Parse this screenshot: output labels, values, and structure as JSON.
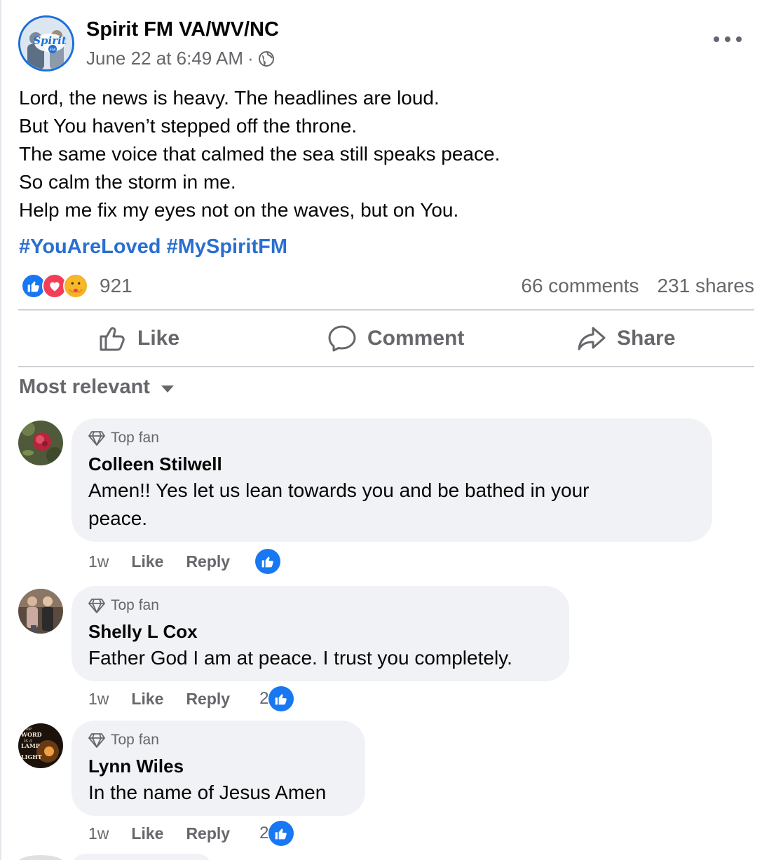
{
  "post": {
    "page_name": "Spirit FM VA/WV/NC",
    "timestamp": "June 22 at 6:49 AM",
    "separator": "·",
    "visibility_icon": "globe-icon",
    "avatar_logo_text": "Spirit",
    "avatar_logo_sub": "FM",
    "body_lines": [
      "Lord, the news is heavy. The headlines are loud.",
      "But You haven’t stepped off the throne.",
      "The same voice that calmed the sea still speaks peace.",
      "So calm the storm in me.",
      "Help me fix my eyes not on the waves, but on You."
    ],
    "hashtags": [
      "#YouAreLoved",
      "#MySpiritFM"
    ],
    "reaction_icons": [
      "like-reaction-icon",
      "love-reaction-icon",
      "care-reaction-icon"
    ],
    "reaction_count": "921",
    "comments_count": "66 comments",
    "shares_count": "231 shares"
  },
  "actions": {
    "like": "Like",
    "comment": "Comment",
    "share": "Share"
  },
  "sort_label": "Most relevant",
  "comments": [
    {
      "badge": "Top fan",
      "author": "Colleen Stilwell",
      "text_lines": [
        "Amen!! Yes let us lean towards you and be bathed in your",
        "peace."
      ],
      "time": "1w",
      "like": "Like",
      "reply": "Reply",
      "like_count": ""
    },
    {
      "badge": "Top fan",
      "author": "Shelly L Cox",
      "text_lines": [
        "Father God I am at peace. I trust you completely."
      ],
      "time": "1w",
      "like": "Like",
      "reply": "Reply",
      "like_count": "2"
    },
    {
      "badge": "Top fan",
      "author": "Lynn Wiles",
      "text_lines": [
        "In the name of Jesus Amen"
      ],
      "time": "1w",
      "like": "Like",
      "reply": "Reply",
      "like_count": "2"
    }
  ],
  "avatar3_text": [
    "The",
    "WORD",
    "is a",
    "LAMP",
    "LIGHT"
  ],
  "colors": {
    "accent": "#1877f2",
    "hashtag": "#2a6fd0",
    "secondary_text": "#65676b",
    "bubble": "#f0f2f5",
    "love": "#f33e58"
  }
}
